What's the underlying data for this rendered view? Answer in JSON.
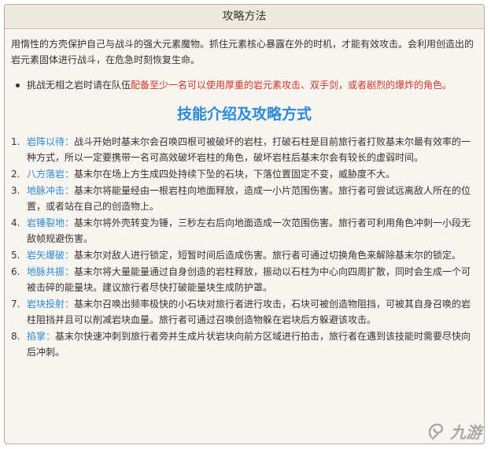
{
  "panel": {
    "title": "攻略方法"
  },
  "intro": "用惰性的方壳保护自己与战斗的强大元素魔物。抓住元素核心暴露在外的时机，才能有效攻击。会利用创造出的岩元素固体进行战斗，在危急时刻恢复生命。",
  "tip": {
    "prefix": "挑战无相之岩时请在队伍",
    "highlight": "配备至少一名可以使用厚重的岩元素攻击、双手剑，或者剧烈的爆炸的角色。"
  },
  "section_title": "技能介绍及攻略方式",
  "skills": [
    {
      "num": "1.",
      "name": "岩阵以待：",
      "desc": "战斗开始时基末尔会召唤四根可被破坏的岩柱，打破石柱是目前旅行者打败基末尔最有效率的一种方式，所以一定要携带一名可高效破坏岩柱的角色，破坏岩柱后基末尔会有较长的虚弱时间。"
    },
    {
      "num": "2.",
      "name": "八方落岩：",
      "desc": "基末尔在场上方生成四处持续下坠的石块，下落位置固定不变，威胁度不大。"
    },
    {
      "num": "3.",
      "name": "地脉冲击：",
      "desc": "基末尔将能量经由一根岩柱向地面释放，造成一小片范围伤害。旅行者可尝试远离敌人所在的位置，或者站在自己的创造物上。"
    },
    {
      "num": "4.",
      "name": "岩锤裂地：",
      "desc": "基末尔将外壳转变为锤，三秒左右后向地面造成一次范围伤害。旅行者可利用角色冲刺一小段无敌帧规避伤害。"
    },
    {
      "num": "5.",
      "name": "岩矢爆破：",
      "desc": "基末尔对敌人进行锁定，短暂时间后造成伤害。旅行者可通过切换角色来解除基末尔的锁定。"
    },
    {
      "num": "6.",
      "name": "地脉共振：",
      "desc": "基末尔将大量能量通过自身创造的岩柱释放，振动以石柱为中心向四周扩散，同时会生成一个可被击碎的能量块。建议旅行者尽快打破能量块生成防护罩。"
    },
    {
      "num": "7.",
      "name": "岩块投射：",
      "desc": "基末尔召唤出频率极快的小石块对旅行者进行攻击，石块可被创造物阻挡，可被其自身召唤的岩柱阻挡并且可以削减岩块血量。旅行者可通过召唤创造物躲在岩块后方躲避该攻击。"
    },
    {
      "num": "8.",
      "name": "掐掌：",
      "desc": "基末尔快速冲刺到旅行者旁并生成片状岩块向前方区域进行拍击，旅行者在遇到该技能时需要尽快向后冲刺。"
    }
  ],
  "watermark": {
    "text": "九游"
  }
}
